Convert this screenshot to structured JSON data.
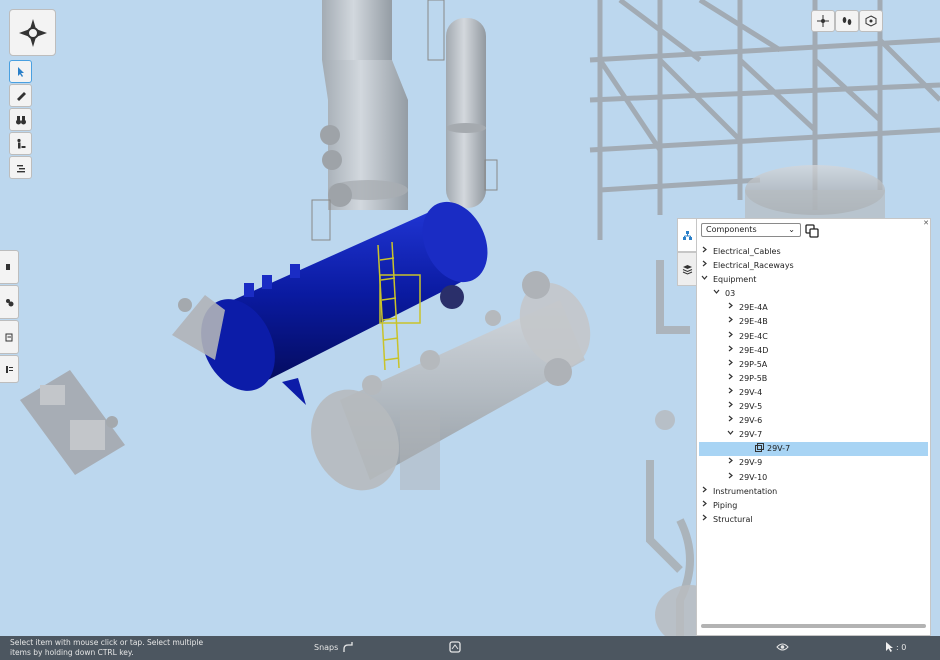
{
  "panel": {
    "dropdown_value": "Components",
    "tree": [
      {
        "label": "Electrical_Cables",
        "level": 0,
        "state": "collapsed"
      },
      {
        "label": "Electrical_Raceways",
        "level": 0,
        "state": "collapsed"
      },
      {
        "label": "Equipment",
        "level": 0,
        "state": "expanded"
      },
      {
        "label": "03",
        "level": 1,
        "state": "expanded"
      },
      {
        "label": "29E-4A",
        "level": 2,
        "state": "collapsed"
      },
      {
        "label": "29E-4B",
        "level": 2,
        "state": "collapsed"
      },
      {
        "label": "29E-4C",
        "level": 2,
        "state": "collapsed"
      },
      {
        "label": "29E-4D",
        "level": 2,
        "state": "collapsed"
      },
      {
        "label": "29P-5A",
        "level": 2,
        "state": "collapsed"
      },
      {
        "label": "29P-5B",
        "level": 2,
        "state": "collapsed"
      },
      {
        "label": "29V-4",
        "level": 2,
        "state": "collapsed"
      },
      {
        "label": "29V-5",
        "level": 2,
        "state": "collapsed"
      },
      {
        "label": "29V-6",
        "level": 2,
        "state": "collapsed"
      },
      {
        "label": "29V-7",
        "level": 2,
        "state": "expanded"
      },
      {
        "label": "29V-7",
        "level": 3,
        "state": "leaf",
        "selected": true
      },
      {
        "label": "29V-9",
        "level": 2,
        "state": "collapsed"
      },
      {
        "label": "29V-10",
        "level": 2,
        "state": "collapsed"
      },
      {
        "label": "Instrumentation",
        "level": 0,
        "state": "collapsed"
      },
      {
        "label": "Piping",
        "level": 0,
        "state": "collapsed"
      },
      {
        "label": "Structural",
        "level": 0,
        "state": "collapsed"
      }
    ]
  },
  "statusbar": {
    "message": "Select item with mouse click or tap. Select multiple items by holding down CTRL key.",
    "snaps_label": "Snaps",
    "selection_count": ": 0"
  },
  "colors": {
    "background": "#bcd7ee",
    "selected_vessel": "#0a1aa0",
    "tree_selection": "#a8d4f4",
    "statusbar": "#4c5660"
  },
  "icons": {
    "main_tool": "compass-gear-icon",
    "left_tools": [
      "select-pointer-icon",
      "measure-ruler-icon",
      "binoculars-icon",
      "walk-person-icon",
      "align-icon"
    ],
    "side_tools": [
      "section-box-icon",
      "hide-show-icon",
      "document-icon",
      "properties-icon"
    ],
    "top_right": [
      "crosshair-icon",
      "footprints-icon",
      "view-cube-icon"
    ],
    "panel_tabs": [
      "hierarchy-tree-icon",
      "layers-icon"
    ]
  }
}
